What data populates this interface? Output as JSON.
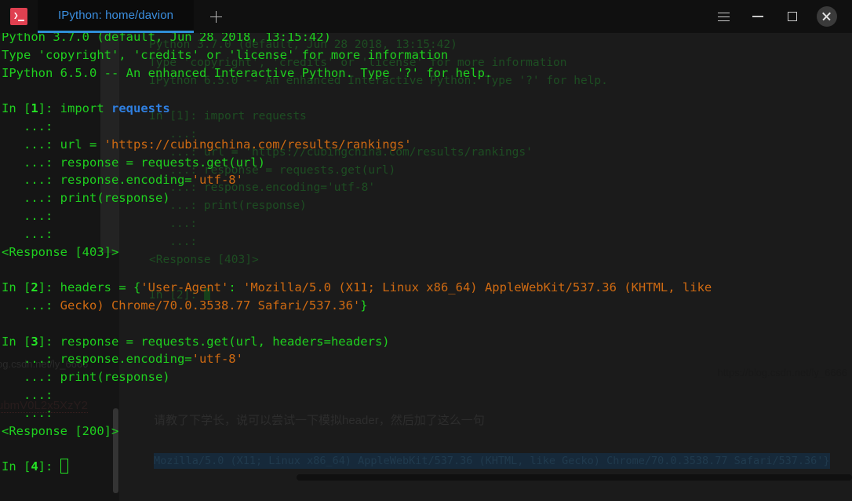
{
  "window": {
    "app_icon": "terminal-icon",
    "tab_label": "IPython: home/davion",
    "new_tab_label": "+",
    "controls": {
      "menu": "hamburger-icon",
      "minimize": "minimize-icon",
      "maximize": "maximize-icon",
      "close": "close-icon"
    }
  },
  "terminal": {
    "banner": [
      "Python 3.7.0 (default, Jun 28 2018, 13:15:42)",
      "Type 'copyright', 'credits' or 'license' for more information",
      "IPython 6.5.0 -- An enhanced Interactive Python. Type '?' for help."
    ],
    "cell1": {
      "prompt_in": "In [",
      "prompt_num": "1",
      "prompt_close": "]: ",
      "stmt_import": "import ",
      "stmt_module": "requests",
      "cont": "   ...: ",
      "cont_blank": "   ...:",
      "line_url_lhs": "url = ",
      "line_url_str": "'https://cubingchina.com/results/rankings'",
      "line_resp": "response = requests.get(url)",
      "line_enc_lhs": "response.encoding=",
      "line_enc_str": "'utf-8'",
      "line_print": "print(response)",
      "output": "<Response [403]>"
    },
    "cell2": {
      "prompt_in": "In [",
      "prompt_num": "2",
      "prompt_close": "]: ",
      "headers_lhs": "headers = ",
      "brace_open": "{",
      "ua_key": "'User-Agent'",
      "colon": ": ",
      "ua_val_part1": "'Mozilla/5.0 (X11; Linux x86_64) AppleWebKit/537.36 (KHTML, like",
      "cont": "   ...: ",
      "ua_val_part2": "Gecko) Chrome/70.0.3538.77 Safari/537.36'",
      "brace_close": "}"
    },
    "cell3": {
      "prompt_in": "In [",
      "prompt_num": "3",
      "prompt_close": "]: ",
      "line_get": "response = requests.get(url, headers=headers)",
      "cont": "   ...: ",
      "cont_blank": "   ...:",
      "line_enc_lhs": "response.encoding=",
      "line_enc_str": "'utf-8'",
      "line_print": "print(response)",
      "output": "<Response [200]>"
    },
    "cell4": {
      "prompt_in": "In [",
      "prompt_num": "4",
      "prompt_close": "]: "
    }
  },
  "background": {
    "ghost_terminal": [
      "Python 3.7.0 (default, Jun 28 2018, 13:15:42)",
      "Type 'copyright', 'credits' or 'license' for more information",
      "IPython 6.5.0 -- An enhanced Interactive Python. Type '?' for help.",
      "",
      "In [1]: import requests",
      "   ...:",
      "   ...: url = 'https://cubingchina.com/results/rankings'",
      "   ...: response = requests.get(url)",
      "   ...: response.encoding='utf-8'",
      "   ...: print(response)",
      "   ...:",
      "   ...:",
      "<Response [403]>",
      "",
      "In [2]: "
    ],
    "chinese_note": "请教了下学长，说可以尝试一下模拟header，然后加了这么一句",
    "user_agent_selection": "Mozilla/5.0 (X11; Linux x86_64) AppleWebKit/537.36 (KHTML, like Gecko) Chrome/70.0.3538.77 Safari/537.36'}",
    "watermark_right": "https://blog.csdn.net/ly_6666",
    "watermark_left": "og.csdn.net/ly_6666",
    "watermark_b64": "ubmV0L2x5XzY2",
    "scrollbar_vertical": "vertical-scrollbar",
    "scrollbar_horizontal": "horizontal-scrollbar"
  },
  "colors": {
    "accent_tab": "#2f8fd8",
    "green": "#1fd01f",
    "orange": "#cf6a12",
    "blue": "#2f7fe0",
    "close_btn": "#3a3a3a"
  }
}
